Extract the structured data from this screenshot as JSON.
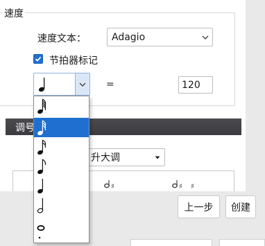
{
  "tempo_group": {
    "title": "速度",
    "tempo_text_label": "速度文本：",
    "tempo_text_value": "Adagio",
    "metronome_label": "节拍器标记",
    "metronome_checked": true,
    "equals_sign": "=",
    "bpm_value": "120"
  },
  "key_section": {
    "header_label": "调号",
    "key_combo_value": "升大调"
  },
  "buttons": {
    "prev_label": "上一步",
    "create_label": "创建"
  },
  "note_dropdown": {
    "items": [
      "64th-note-icon",
      "32nd-note-icon",
      "16th-note-icon",
      "eighth-note-icon",
      "quarter-note-icon",
      "half-note-icon",
      "whole-note-icon",
      "breve-icon"
    ],
    "selected_index": 1
  },
  "colors": {
    "accent": "#1f6fd0",
    "header_dark": "#3b3b40"
  }
}
